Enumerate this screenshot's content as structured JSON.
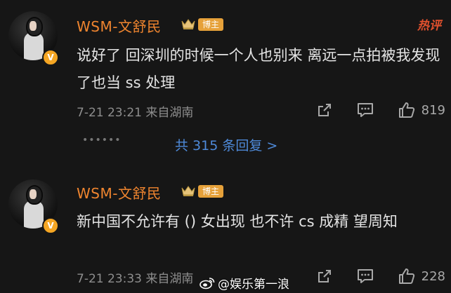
{
  "comments": [
    {
      "username": "WSM-文舒民",
      "author_tag": "博主",
      "hot_tag": "热评",
      "text": "说好了 回深圳的时候一个人也别来 离远一点拍被我发现了也当 ss 处理",
      "timestamp": "7-21 23:21",
      "location": "来自湖南",
      "likes": "819",
      "more_dots": "••••••",
      "replies_link": "共 315 条回复",
      "replies_chevron": ">"
    },
    {
      "username": "WSM-文舒民",
      "author_tag": "博主",
      "text": "新中国不允许有 () 女出现 也不许 cs 成精 望周知",
      "timestamp": "7-21 23:33",
      "location": "来自湖南",
      "likes": "228"
    }
  ],
  "icons": {
    "verified": "verified-v-icon",
    "crown": "crown-icon",
    "share": "share-icon",
    "reply": "comment-bubble-icon",
    "like": "thumbs-up-icon",
    "watermark": "weibo-logo-icon"
  },
  "watermark": "@娱乐第一浪",
  "colors": {
    "background": "#161616",
    "username": "#f0852f",
    "hot_tag": "#e0502d",
    "link": "#4e8ad9",
    "author_tag_bg": "#e6a13a"
  }
}
